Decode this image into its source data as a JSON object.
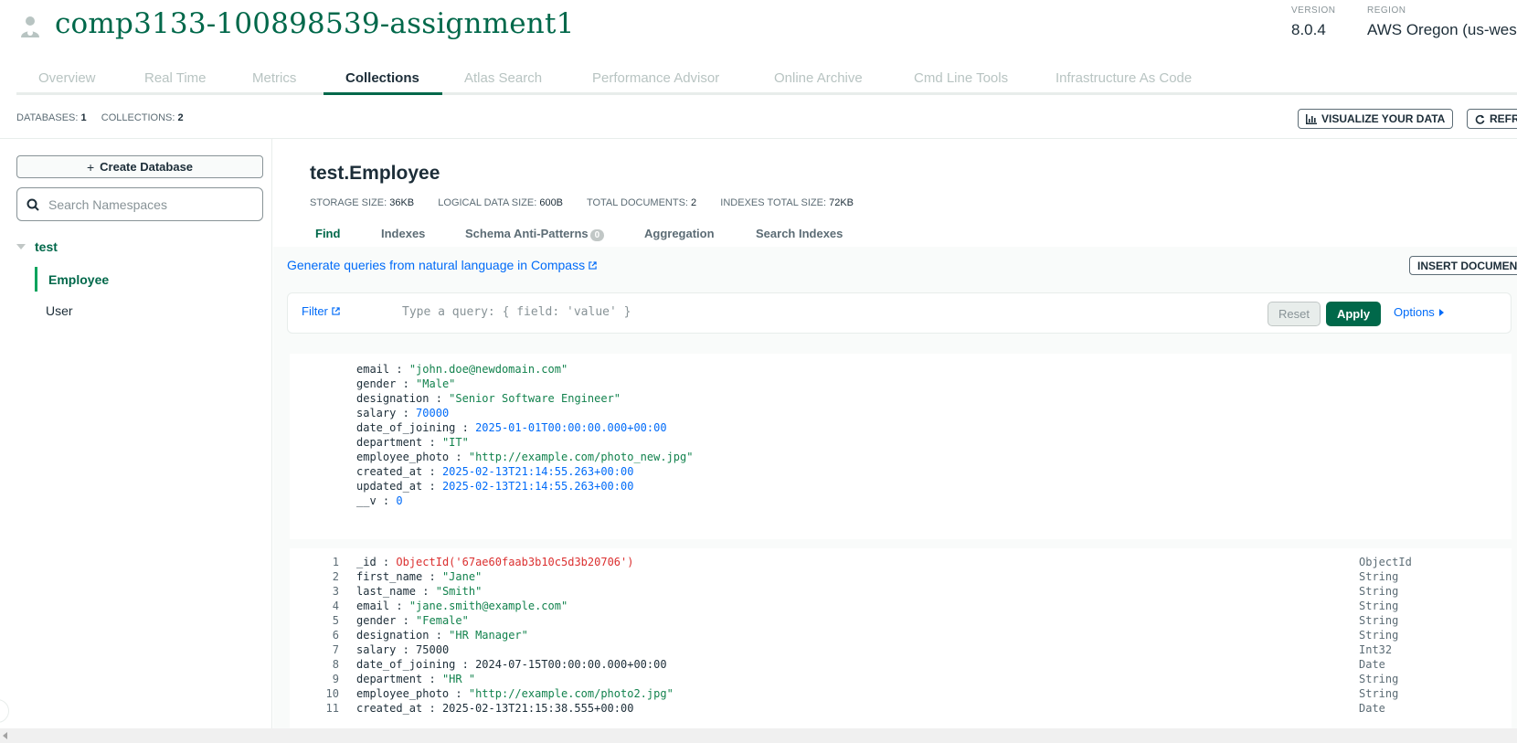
{
  "project": {
    "title": "comp3133-100898539-assignment1",
    "icon": "leaf-users-icon"
  },
  "header_meta": {
    "version_label": "VERSION",
    "version_value": "8.0.4",
    "region_label": "REGION",
    "region_value": "AWS Oregon (us-wes"
  },
  "tabs": [
    {
      "label": "Overview"
    },
    {
      "label": "Real Time"
    },
    {
      "label": "Metrics"
    },
    {
      "label": "Collections"
    },
    {
      "label": "Atlas Search"
    },
    {
      "label": "Performance Advisor"
    },
    {
      "label": "Online Archive"
    },
    {
      "label": "Cmd Line Tools"
    },
    {
      "label": "Infrastructure As Code"
    }
  ],
  "active_tab": "Collections",
  "counts": {
    "databases_label": "DATABASES:",
    "databases_value": "1",
    "collections_label": "COLLECTIONS:",
    "collections_value": "2"
  },
  "toolbar": {
    "visualize_label": "VISUALIZE YOUR DATA",
    "refresh_label": "REFRE"
  },
  "sidebar": {
    "create_db_label": "Create Database",
    "search_placeholder": "Search Namespaces",
    "database": "test",
    "collections": [
      "Employee",
      "User"
    ]
  },
  "collection": {
    "title": "test.Employee",
    "storage_label": "STORAGE SIZE:",
    "storage_value": "36KB",
    "logical_label": "LOGICAL DATA SIZE:",
    "logical_value": "600B",
    "docs_label": "TOTAL DOCUMENTS:",
    "docs_value": "2",
    "indexes_label": "INDEXES TOTAL SIZE:",
    "indexes_value": "72KB"
  },
  "subtabs": {
    "find": "Find",
    "indexes": "Indexes",
    "schema": "Schema Anti-Patterns",
    "schema_badge": "0",
    "aggregation": "Aggregation",
    "search_indexes": "Search Indexes"
  },
  "gen_link": "Generate queries from natural language in Compass",
  "insert_label": "INSERT DOCUMENT",
  "filter": {
    "label": "Filter",
    "placeholder": "Type a query: { field: 'value' }",
    "reset": "Reset",
    "apply": "Apply",
    "options": "Options"
  },
  "doc1": [
    {
      "key": "email",
      "val": "\"john.doe@newdomain.com\"",
      "kind": "str"
    },
    {
      "key": "gender",
      "val": "\"Male\"",
      "kind": "str"
    },
    {
      "key": "designation",
      "val": "\"Senior Software Engineer\"",
      "kind": "str"
    },
    {
      "key": "salary",
      "val": "70000",
      "kind": "num"
    },
    {
      "key": "date_of_joining",
      "val": "2025-01-01T00:00:00.000+00:00",
      "kind": "num"
    },
    {
      "key": "department",
      "val": "\"IT\"",
      "kind": "str"
    },
    {
      "key": "employee_photo",
      "val": "\"http://example.com/photo_new.jpg\"",
      "kind": "str"
    },
    {
      "key": "created_at",
      "val": "2025-02-13T21:14:55.263+00:00",
      "kind": "num"
    },
    {
      "key": "updated_at",
      "val": "2025-02-13T21:14:55.263+00:00",
      "kind": "num"
    },
    {
      "key": "__v",
      "val": "0",
      "kind": "num"
    }
  ],
  "doc2": [
    {
      "ln": "1",
      "key": "_id",
      "val": "ObjectId('67ae60faab3b10c5d3b20706')",
      "kind": "oid",
      "type": "ObjectId"
    },
    {
      "ln": "2",
      "key": "first_name",
      "val": "\"Jane\"",
      "kind": "str",
      "type": "String"
    },
    {
      "ln": "3",
      "key": "last_name",
      "val": "\"Smith\"",
      "kind": "str",
      "type": "String"
    },
    {
      "ln": "4",
      "key": "email",
      "val": "\"jane.smith@example.com\"",
      "kind": "str",
      "type": "String"
    },
    {
      "ln": "5",
      "key": "gender",
      "val": "\"Female\"",
      "kind": "str",
      "type": "String"
    },
    {
      "ln": "6",
      "key": "designation",
      "val": "\"HR Manager\"",
      "kind": "str",
      "type": "String"
    },
    {
      "ln": "7",
      "key": "salary",
      "val": "75000",
      "kind": "plain",
      "type": "Int32"
    },
    {
      "ln": "8",
      "key": "date_of_joining",
      "val": "2024-07-15T00:00:00.000+00:00",
      "kind": "plain",
      "type": "Date"
    },
    {
      "ln": "9",
      "key": "department",
      "val": "\"HR \"",
      "kind": "str",
      "type": "String"
    },
    {
      "ln": "10",
      "key": "employee_photo",
      "val": "\"http://example.com/photo2.jpg\"",
      "kind": "str",
      "type": "String"
    },
    {
      "ln": "11",
      "key": "created_at",
      "val": "2025-02-13T21:15:38.555+00:00",
      "kind": "plain",
      "type": "Date"
    }
  ]
}
